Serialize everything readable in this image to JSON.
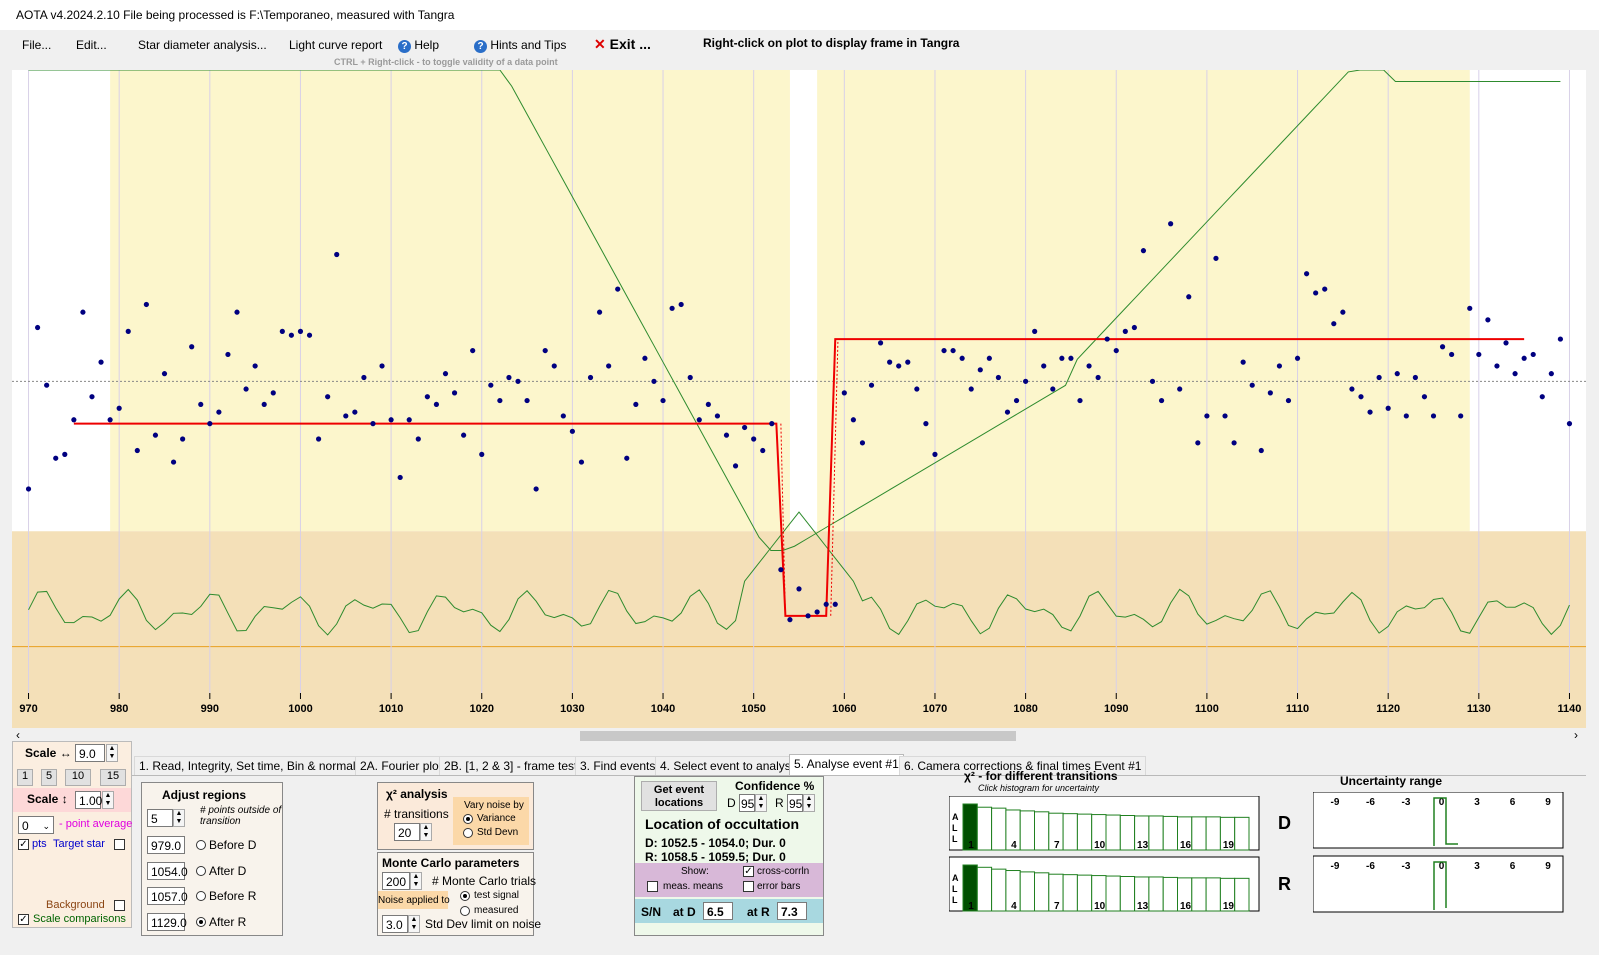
{
  "window": {
    "title": "AOTA v4.2024.2.10    File being processed is F:\\Temporaneo, measured with Tangra"
  },
  "menu": {
    "file": "File...",
    "edit": "Edit...",
    "star_diameter": "Star diameter analysis...",
    "light_curve": "Light curve report",
    "help": "Help",
    "hints": "Hints and Tips",
    "exit": "Exit ...",
    "ctrl_hint": "CTRL + Right-click  -  to toggle validity of a data point",
    "right_click_hint": "Right-click on plot to display frame in Tangra"
  },
  "chart_data": {
    "type": "scatter",
    "x_ticks": [
      970,
      980,
      990,
      1000,
      1010,
      1020,
      1030,
      1040,
      1050,
      1060,
      1070,
      1080,
      1090,
      1100,
      1110,
      1120,
      1130,
      1140
    ],
    "xlim": [
      969.5,
      1140.5
    ],
    "ylim": [
      -0.15,
      1.45
    ],
    "regions": {
      "before_d": [
        979.0,
        1054.0
      ],
      "after_r": [
        1057.0,
        1129.0
      ]
    },
    "points": [
      [
        970,
        0.36
      ],
      [
        971,
        0.78
      ],
      [
        972,
        0.63
      ],
      [
        973,
        0.44
      ],
      [
        974,
        0.45
      ],
      [
        975,
        0.54
      ],
      [
        976,
        0.82
      ],
      [
        977,
        0.6
      ],
      [
        978,
        0.69
      ],
      [
        979,
        0.54
      ],
      [
        980,
        0.57
      ],
      [
        981,
        0.77
      ],
      [
        982,
        0.46
      ],
      [
        983,
        0.84
      ],
      [
        984,
        0.5
      ],
      [
        985,
        0.66
      ],
      [
        986,
        0.43
      ],
      [
        987,
        0.49
      ],
      [
        988,
        0.73
      ],
      [
        989,
        0.58
      ],
      [
        990,
        0.53
      ],
      [
        991,
        0.56
      ],
      [
        992,
        0.71
      ],
      [
        993,
        0.82
      ],
      [
        994,
        0.62
      ],
      [
        995,
        0.68
      ],
      [
        996,
        0.58
      ],
      [
        997,
        0.61
      ],
      [
        998,
        0.77
      ],
      [
        999,
        0.76
      ],
      [
        1000,
        0.77
      ],
      [
        1001,
        0.76
      ],
      [
        1002,
        0.49
      ],
      [
        1003,
        0.6
      ],
      [
        1004,
        0.97
      ],
      [
        1005,
        0.55
      ],
      [
        1006,
        0.56
      ],
      [
        1007,
        0.65
      ],
      [
        1008,
        0.53
      ],
      [
        1009,
        0.68
      ],
      [
        1010,
        0.54
      ],
      [
        1011,
        0.39
      ],
      [
        1012,
        0.54
      ],
      [
        1013,
        0.49
      ],
      [
        1014,
        0.6
      ],
      [
        1015,
        0.58
      ],
      [
        1016,
        0.66
      ],
      [
        1017,
        0.61
      ],
      [
        1018,
        0.5
      ],
      [
        1019,
        0.72
      ],
      [
        1020,
        0.45
      ],
      [
        1021,
        0.63
      ],
      [
        1022,
        0.59
      ],
      [
        1023,
        0.65
      ],
      [
        1024,
        0.64
      ],
      [
        1025,
        0.59
      ],
      [
        1026,
        0.36
      ],
      [
        1027,
        0.72
      ],
      [
        1028,
        0.68
      ],
      [
        1029,
        0.55
      ],
      [
        1030,
        0.51
      ],
      [
        1031,
        0.43
      ],
      [
        1032,
        0.65
      ],
      [
        1033,
        0.82
      ],
      [
        1034,
        0.68
      ],
      [
        1035,
        0.88
      ],
      [
        1036,
        0.44
      ],
      [
        1037,
        0.58
      ],
      [
        1038,
        0.7
      ],
      [
        1039,
        0.64
      ],
      [
        1040,
        0.59
      ],
      [
        1041,
        0.83
      ],
      [
        1042,
        0.84
      ],
      [
        1043,
        0.65
      ],
      [
        1044,
        0.54
      ],
      [
        1045,
        0.58
      ],
      [
        1046,
        0.55
      ],
      [
        1047,
        0.5
      ],
      [
        1048,
        0.42
      ],
      [
        1049,
        0.52
      ],
      [
        1050,
        0.49
      ],
      [
        1051,
        0.46
      ],
      [
        1052,
        0.53
      ],
      [
        1053,
        0.15
      ],
      [
        1054,
        0.02
      ],
      [
        1055,
        0.1
      ],
      [
        1056,
        0.03
      ],
      [
        1057,
        0.04
      ],
      [
        1058,
        0.06
      ],
      [
        1059,
        0.06
      ],
      [
        1060,
        0.61
      ],
      [
        1061,
        0.54
      ],
      [
        1062,
        0.48
      ],
      [
        1063,
        0.63
      ],
      [
        1064,
        0.74
      ],
      [
        1065,
        0.69
      ],
      [
        1066,
        0.68
      ],
      [
        1067,
        0.69
      ],
      [
        1068,
        0.62
      ],
      [
        1069,
        0.53
      ],
      [
        1070,
        0.45
      ],
      [
        1071,
        0.72
      ],
      [
        1072,
        0.72
      ],
      [
        1073,
        0.7
      ],
      [
        1074,
        0.62
      ],
      [
        1075,
        0.67
      ],
      [
        1076,
        0.7
      ],
      [
        1077,
        0.65
      ],
      [
        1078,
        0.56
      ],
      [
        1079,
        0.59
      ],
      [
        1080,
        0.64
      ],
      [
        1081,
        0.77
      ],
      [
        1082,
        0.68
      ],
      [
        1083,
        0.62
      ],
      [
        1084,
        0.7
      ],
      [
        1085,
        0.7
      ],
      [
        1086,
        0.59
      ],
      [
        1087,
        0.68
      ],
      [
        1088,
        0.65
      ],
      [
        1089,
        0.75
      ],
      [
        1090,
        0.72
      ],
      [
        1091,
        0.77
      ],
      [
        1092,
        0.78
      ],
      [
        1093,
        0.98
      ],
      [
        1094,
        0.64
      ],
      [
        1095,
        0.59
      ],
      [
        1096,
        1.05
      ],
      [
        1097,
        0.62
      ],
      [
        1098,
        0.86
      ],
      [
        1099,
        0.48
      ],
      [
        1100,
        0.55
      ],
      [
        1101,
        0.96
      ],
      [
        1102,
        0.55
      ],
      [
        1103,
        0.48
      ],
      [
        1104,
        0.69
      ],
      [
        1105,
        0.63
      ],
      [
        1106,
        0.46
      ],
      [
        1107,
        0.61
      ],
      [
        1108,
        0.68
      ],
      [
        1109,
        0.59
      ],
      [
        1110,
        0.7
      ],
      [
        1111,
        0.92
      ],
      [
        1112,
        0.87
      ],
      [
        1113,
        0.88
      ],
      [
        1114,
        0.79
      ],
      [
        1115,
        0.82
      ],
      [
        1116,
        0.62
      ],
      [
        1117,
        0.6
      ],
      [
        1118,
        0.56
      ],
      [
        1119,
        0.65
      ],
      [
        1120,
        0.57
      ],
      [
        1121,
        0.66
      ],
      [
        1122,
        0.55
      ],
      [
        1123,
        0.65
      ],
      [
        1124,
        0.6
      ],
      [
        1125,
        0.55
      ],
      [
        1126,
        0.73
      ],
      [
        1127,
        0.71
      ],
      [
        1128,
        0.55
      ],
      [
        1129,
        0.83
      ],
      [
        1130,
        0.71
      ],
      [
        1131,
        0.8
      ],
      [
        1132,
        0.68
      ],
      [
        1133,
        0.74
      ],
      [
        1134,
        0.66
      ],
      [
        1135,
        0.7
      ],
      [
        1136,
        0.71
      ],
      [
        1137,
        0.6
      ],
      [
        1138,
        0.66
      ],
      [
        1139,
        0.75
      ],
      [
        1140,
        0.53
      ]
    ],
    "model": {
      "baseline": 0.53,
      "event": 0.03,
      "after": 0.75,
      "d_time": 1053,
      "r_time": 1058.5
    },
    "chi2_d": [
      0.3,
      0.23,
      0.21,
      0.17,
      0.15,
      0.13,
      0.1,
      0.09,
      0.08,
      0.07,
      0.06,
      0.05,
      0.04,
      0.04,
      0.03,
      0.02,
      0.02,
      0.02,
      0.01,
      0.01
    ],
    "chi2_r": [
      0.3,
      0.25,
      0.21,
      0.18,
      0.15,
      0.13,
      0.1,
      0.09,
      0.08,
      0.07,
      0.06,
      0.05,
      0.04,
      0.04,
      0.03,
      0.02,
      0.02,
      0.02,
      0.01,
      0.01
    ]
  },
  "tabs": [
    "1.  Read, Integrity, Set time, Bin & normalise",
    "2A. Fourier plot",
    "2B. [1, 2 & 3] - frame test",
    "3. Find events",
    "4. Select event to analyse",
    "5. Analyse event #1",
    "6. Camera corrections & final times Event #1"
  ],
  "scale": {
    "scale_h_label": "Scale ↔",
    "scale_h_value": "9.0",
    "presets": [
      "1",
      "5",
      "10",
      "15"
    ],
    "scale_v_label": "Scale ↕",
    "scale_v_value": "1.00",
    "point_avg_value": "0",
    "point_avg_label": "- point average",
    "pts_label": "pts",
    "target_star_label": "Target star",
    "background_label": "Background",
    "scale_comparisons_label": "Scale comparisons"
  },
  "adjust": {
    "title": "Adjust regions",
    "points_value": "5",
    "points_label": "# points outside of transition",
    "before_d_value": "979.0",
    "before_d_label": "Before D",
    "after_d_value": "1054.0",
    "after_d_label": "After D",
    "before_r_value": "1057.0",
    "before_r_label": "Before R",
    "after_r_value": "1129.0",
    "after_r_label": "After R"
  },
  "chi2": {
    "title": "χ² analysis",
    "transitions_label": "# transitions",
    "transitions_value": "20",
    "vary_label": "Vary noise by",
    "variance_label": "Variance",
    "stddev_label": "Std Devn"
  },
  "monte": {
    "title": "Monte Carlo parameters",
    "trials_value": "200",
    "trials_label": "# Monte Carlo trials",
    "noise_applied_label": "Noise applied to",
    "test_signal_label": "test signal",
    "measured_label": "measured",
    "limit_value": "3.0",
    "limit_label": "Std Dev limit on noise"
  },
  "location": {
    "get_button": "Get event locations",
    "confidence_label": "Confidence %",
    "d_label": "D",
    "d_value": "95",
    "r_label": "R",
    "r_value": "95",
    "title": "Location of occultation",
    "d_line": "D: 1052.5 - 1054.0; Dur. 0",
    "r_line": "R: 1058.5 - 1059.5; Dur. 0",
    "show_label": "Show:",
    "cross_label": "cross-corrln",
    "means_label": "meas. means",
    "errorbars_label": "error bars",
    "sn_label": "S/N",
    "at_d_label": "at D",
    "at_d_value": "6.5",
    "at_r_label": "at R",
    "at_r_value": "7.3"
  },
  "histogram": {
    "title": "χ² - for different transitions",
    "subtitle": "Click histogram for uncertainty",
    "all_label": "A L L",
    "tick_labels": [
      "1",
      "4",
      "7",
      "10",
      "13",
      "16",
      "19"
    ],
    "d_label": "D",
    "r_label": "R"
  },
  "uncertainty": {
    "title": "Uncertainty range",
    "ticks": [
      "-9",
      "-6",
      "-3",
      "0",
      "3",
      "6",
      "9"
    ]
  },
  "colors": {
    "plot_yellow": "#fcf6cc",
    "plot_tan": "#f4e0b8",
    "model_red": "#ee0000",
    "curve_green": "#2e8b2e",
    "point_navy": "#000080",
    "sn_bg": "#a8d8e0",
    "show_bg": "#d8b8d8"
  }
}
